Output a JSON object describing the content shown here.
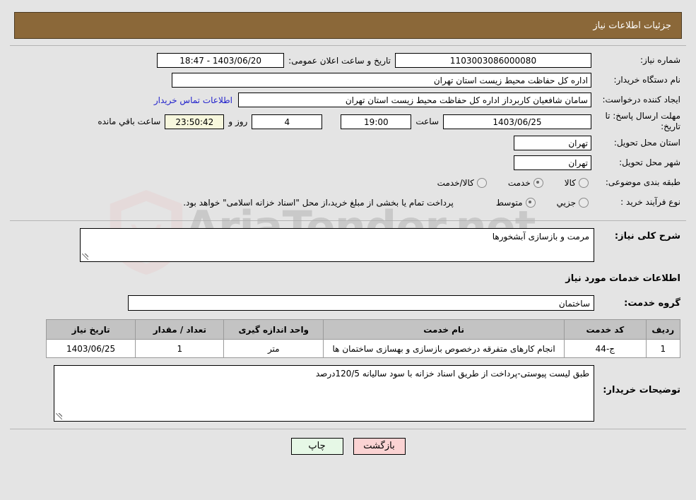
{
  "header": {
    "title": "جزئیات اطلاعات نیاز"
  },
  "watermark": {
    "text": "AriaTender.net",
    "shield_color": "#e8c4c4",
    "text_color": "#b9b9b9"
  },
  "info": {
    "need_number_label": "شماره نیاز:",
    "need_number_value": "1103003086000080",
    "announce_label": "تاریخ و ساعت اعلان عمومی:",
    "announce_value": "1403/06/20 - 18:47",
    "buyer_org_label": "نام دستگاه خریدار:",
    "buyer_org_value": "اداره کل حفاظت محیط زیست استان تهران",
    "creator_label": "ایجاد کننده درخواست:",
    "creator_value": "سامان شافعیان کاربرداز اداره کل حفاظت محیط زیست استان تهران",
    "contact_link": "اطلاعات تماس خریدار",
    "deadline_label": "مهلت ارسال پاسخ: تا تاریخ:",
    "deadline_date": "1403/06/25",
    "deadline_hour_label": "ساعت",
    "deadline_hour": "19:00",
    "remaining_days": "4",
    "remaining_days_suffix": "روز و",
    "remaining_timer": "23:50:42",
    "remaining_timer_suffix": "ساعت باقي مانده",
    "province_label": "استان محل تحویل:",
    "province_value": "تهران",
    "city_label": "شهر محل تحویل:",
    "city_value": "تهران",
    "category_label": "طبقه بندی موضوعی:",
    "category_options": [
      {
        "label": "کالا",
        "selected": false
      },
      {
        "label": "خدمت",
        "selected": true
      },
      {
        "label": "کالا/خدمت",
        "selected": false
      }
    ],
    "process_label": "نوع فرآیند خرید :",
    "process_options": [
      {
        "label": "جزیي",
        "selected": false
      },
      {
        "label": "متوسط",
        "selected": true
      }
    ],
    "process_note": "پرداخت تمام یا بخشی از مبلغ خرید،از محل \"اسناد خزانه اسلامی\" خواهد بود."
  },
  "detail": {
    "desc_label": "شرح کلی نیاز:",
    "desc_value": "مرمت و بازسازی آبشخورها",
    "services_title": "اطلاعات خدمات مورد نیاز",
    "group_label": "گروه خدمت:",
    "group_value": "ساختمان",
    "remark_label": "توضیحات خریدار:",
    "remark_value": "طبق لیست پیوستی-پرداخت از طریق اسناد خزانه با سود سالیانه 120/5درصد"
  },
  "table": {
    "columns": [
      "ردیف",
      "کد خدمت",
      "نام خدمت",
      "واحد اندازه گیری",
      "تعداد / مقدار",
      "تاریخ نیاز"
    ],
    "rows": [
      {
        "index": "1",
        "code": "ج-44",
        "name": "انجام کارهای متفرقه درخصوص بازسازی و بهسازی ساختمان ها",
        "unit": "متر",
        "qty": "1",
        "date": "1403/06/25"
      }
    ]
  },
  "footer": {
    "print_label": "چاپ",
    "back_label": "بازگشت"
  }
}
